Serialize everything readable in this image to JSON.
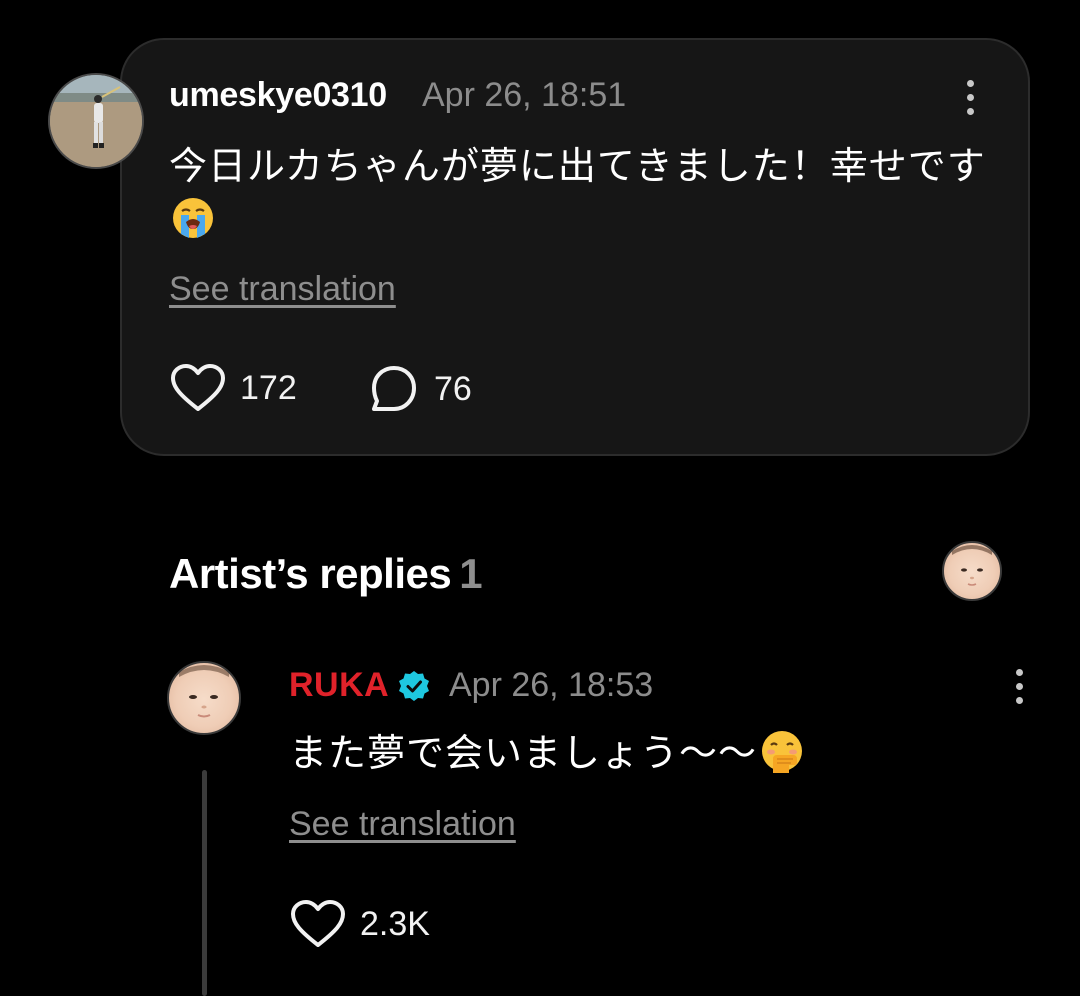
{
  "post": {
    "username": "umeskye0310",
    "timestamp": "Apr 26, 18:51",
    "text": "今日ルカちゃんが夢に出てきました！幸せです",
    "emoji": "loudly-crying-face",
    "see_translation": "See translation",
    "likes": "172",
    "replies": "76"
  },
  "artist_replies": {
    "title": "Artist’s replies",
    "count": "1"
  },
  "reply": {
    "username": "RUKA",
    "verified": true,
    "timestamp": "Apr 26, 18:53",
    "text": "また夢で会いましょう〜〜",
    "emoji": "face-with-hand-over-mouth",
    "see_translation": "See translation",
    "likes": "2.3K"
  },
  "colors": {
    "background": "#000000",
    "card": "#161616",
    "artist_name": "#e0222a",
    "verified_badge": "#1ec8e0",
    "muted_text": "#8c8c8c"
  }
}
